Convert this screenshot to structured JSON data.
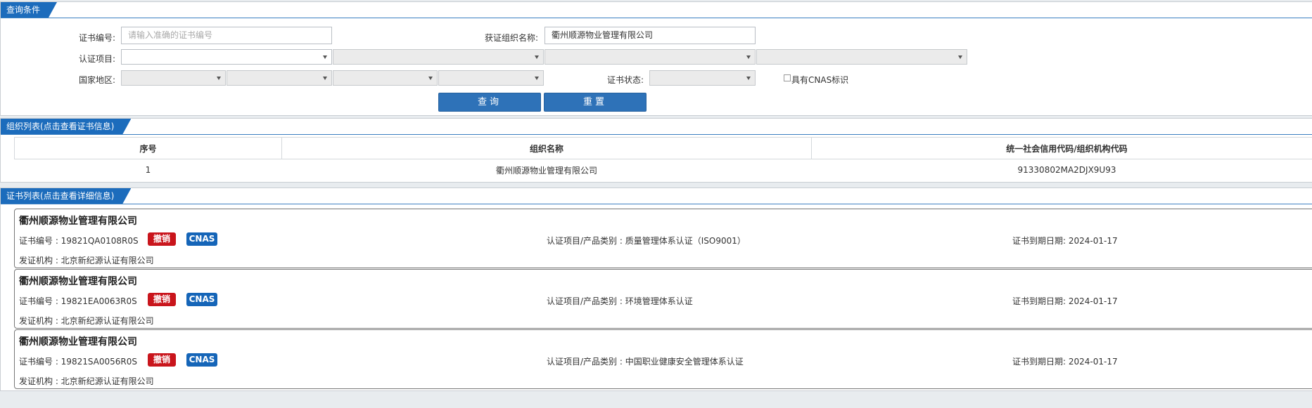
{
  "query_panel": {
    "tab_label": "查询条件",
    "cert_no_label": "证书编号:",
    "cert_no_placeholder": "请输入准确的证书编号",
    "org_name_label": "获证组织名称:",
    "org_name_value": "衢州顺源物业管理有限公司",
    "cert_item_label": "认证项目:",
    "region_label": "国家地区:",
    "status_label": "证书状态:",
    "cnas_checkbox_label": "具有CNAS标识",
    "query_button": "查询",
    "reset_button": "重置"
  },
  "org_panel": {
    "tab_label": "组织列表(点击查看证书信息)",
    "columns": [
      "序号",
      "组织名称",
      "统一社会信用代码/组织机构代码"
    ],
    "rows": [
      {
        "index": "1",
        "name": "衢州顺源物业管理有限公司",
        "code": "91330802MA2DJX9U93"
      }
    ]
  },
  "cert_panel": {
    "tab_label": "证书列表(点击查看详细信息)",
    "cards": [
      {
        "org": "衢州顺源物业管理有限公司",
        "cert_no": "证书编号 : 19821QA0108R0S",
        "status_badge": "撤销",
        "cnas_badge": "CNAS",
        "item": "认证项目/产品类别 : 质量管理体系认证（ISO9001）",
        "expire": "证书到期日期: 2024-01-17",
        "issuer": "发证机构 : 北京新纪源认证有限公司"
      },
      {
        "org": "衢州顺源物业管理有限公司",
        "cert_no": "证书编号 : 19821EA0063R0S",
        "status_badge": "撤销",
        "cnas_badge": "CNAS",
        "item": "认证项目/产品类别 : 环境管理体系认证",
        "expire": "证书到期日期: 2024-01-17",
        "issuer": "发证机构 : 北京新纪源认证有限公司"
      },
      {
        "org": "衢州顺源物业管理有限公司",
        "cert_no": "证书编号 : 19821SA0056R0S",
        "status_badge": "撤销",
        "cnas_badge": "CNAS",
        "item": "认证项目/产品类别 : 中国职业健康安全管理体系认证",
        "expire": "证书到期日期: 2024-01-17",
        "issuer": "发证机构 : 北京新纪源认证有限公司"
      }
    ]
  },
  "colors": {
    "tab_blue": "#1c6cbc",
    "button_blue": "#2e72b8",
    "revoked_red": "#c9151c",
    "cnas_blue": "#1565b8"
  }
}
